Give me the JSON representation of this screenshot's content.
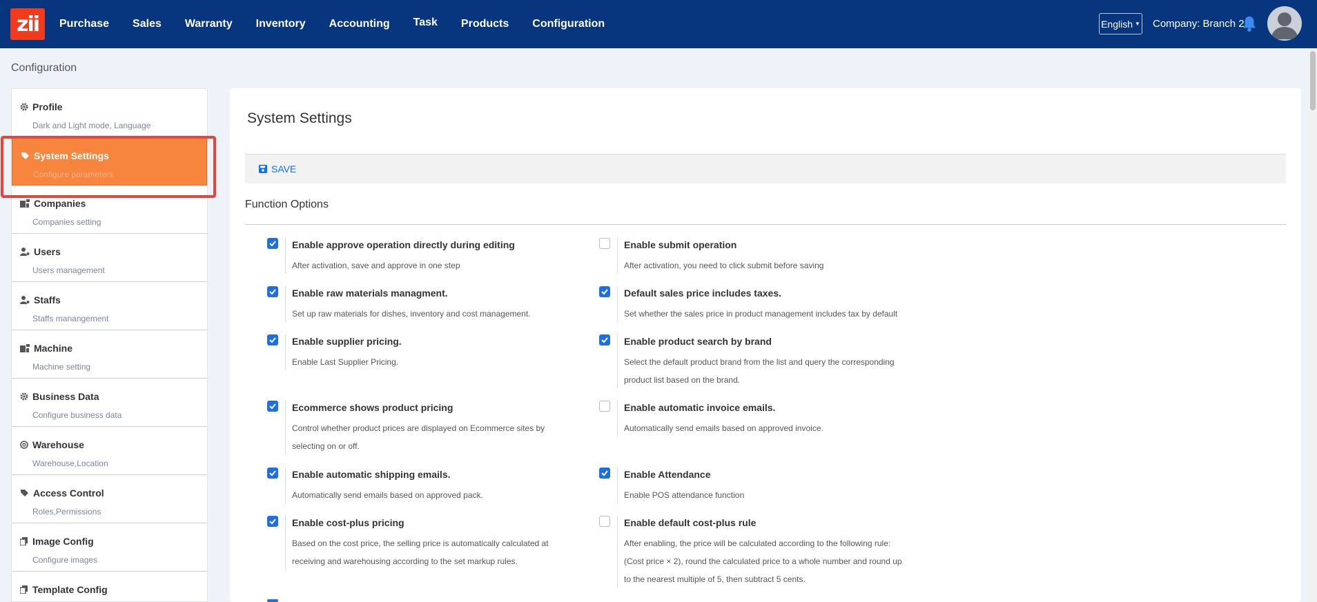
{
  "nav": {
    "logo_text": "zii",
    "items": [
      "Purchase",
      "Sales",
      "Warranty",
      "Inventory",
      "Accounting",
      "Task",
      "Products",
      "Configuration"
    ],
    "language": "English",
    "company": "Company: Branch 2"
  },
  "breadcrumb": "Configuration",
  "sidebar": {
    "items": [
      {
        "title": "Profile",
        "subtitle": "Dark and Light mode, Language",
        "icon": "gear-icon"
      },
      {
        "title": "System Settings",
        "subtitle": "Configure parameters",
        "icon": "tag-icon"
      },
      {
        "title": "Companies",
        "subtitle": "Companies setting",
        "icon": "building-icon"
      },
      {
        "title": "Users",
        "subtitle": "Users management",
        "icon": "user-gear-icon"
      },
      {
        "title": "Staffs",
        "subtitle": "Staffs manangement",
        "icon": "user-gear-icon"
      },
      {
        "title": "Machine",
        "subtitle": "Machine setting",
        "icon": "building-icon"
      },
      {
        "title": "Business Data",
        "subtitle": "Configure business data",
        "icon": "gear-icon"
      },
      {
        "title": "Warehouse",
        "subtitle": "Warehouse,Location",
        "icon": "lifebuoy-icon"
      },
      {
        "title": "Access Control",
        "subtitle": "Roles,Permissions",
        "icon": "tag-icon"
      },
      {
        "title": "Image Config",
        "subtitle": "Configure images",
        "icon": "copy-icon"
      },
      {
        "title": "Template Config",
        "subtitle": "",
        "icon": "copy-icon"
      }
    ]
  },
  "main": {
    "title": "System Settings",
    "save_label": "SAVE",
    "section_title": "Function Options",
    "options": [
      {
        "title": "Enable approve operation directly during editing",
        "desc": "After activation, save and approve in one step",
        "checked": true
      },
      {
        "title": "Enable submit operation",
        "desc": "After activation, you need to click submit before saving",
        "checked": false
      },
      {
        "title": "Enable raw materials managment.",
        "desc": "Set up raw materials for dishes, inventory and cost management.",
        "checked": true
      },
      {
        "title": "Default sales price includes taxes.",
        "desc": "Set whether the sales price in product management includes tax by default",
        "checked": true
      },
      {
        "title": "Enable supplier pricing.",
        "desc": "Enable Last Supplier Pricing.",
        "checked": true
      },
      {
        "title": "Enable product search by brand",
        "desc": "Select the default product brand from the list and query the corresponding product list based on the brand.",
        "checked": true
      },
      {
        "title": "Ecommerce shows product pricing",
        "desc": "Control whether product prices are displayed on Ecommerce sites by selecting on or off.",
        "checked": true
      },
      {
        "title": "Enable automatic invoice emails.",
        "desc": "Automatically send emails based on approved invoice.",
        "checked": false
      },
      {
        "title": "Enable automatic shipping emails.",
        "desc": "Automatically send emails based on approved pack.",
        "checked": true
      },
      {
        "title": "Enable Attendance",
        "desc": "Enable POS attendance function",
        "checked": true
      },
      {
        "title": "Enable cost-plus pricing",
        "desc": "Based on the cost price, the selling price is automatically calculated at receiving and warehousing according to the set markup rules.",
        "checked": true
      },
      {
        "title": "Enable default cost-plus rule",
        "desc": "After enabling, the price will be calculated according to the following rule: (Cost price × 2), round the calculated price to a whole number and round up to the nearest multiple of 5, then subtract 5 cents.",
        "checked": false
      }
    ]
  },
  "colors": {
    "nav_bg": "#07367e",
    "accent": "#f7853e",
    "check": "#1f6fe0"
  }
}
